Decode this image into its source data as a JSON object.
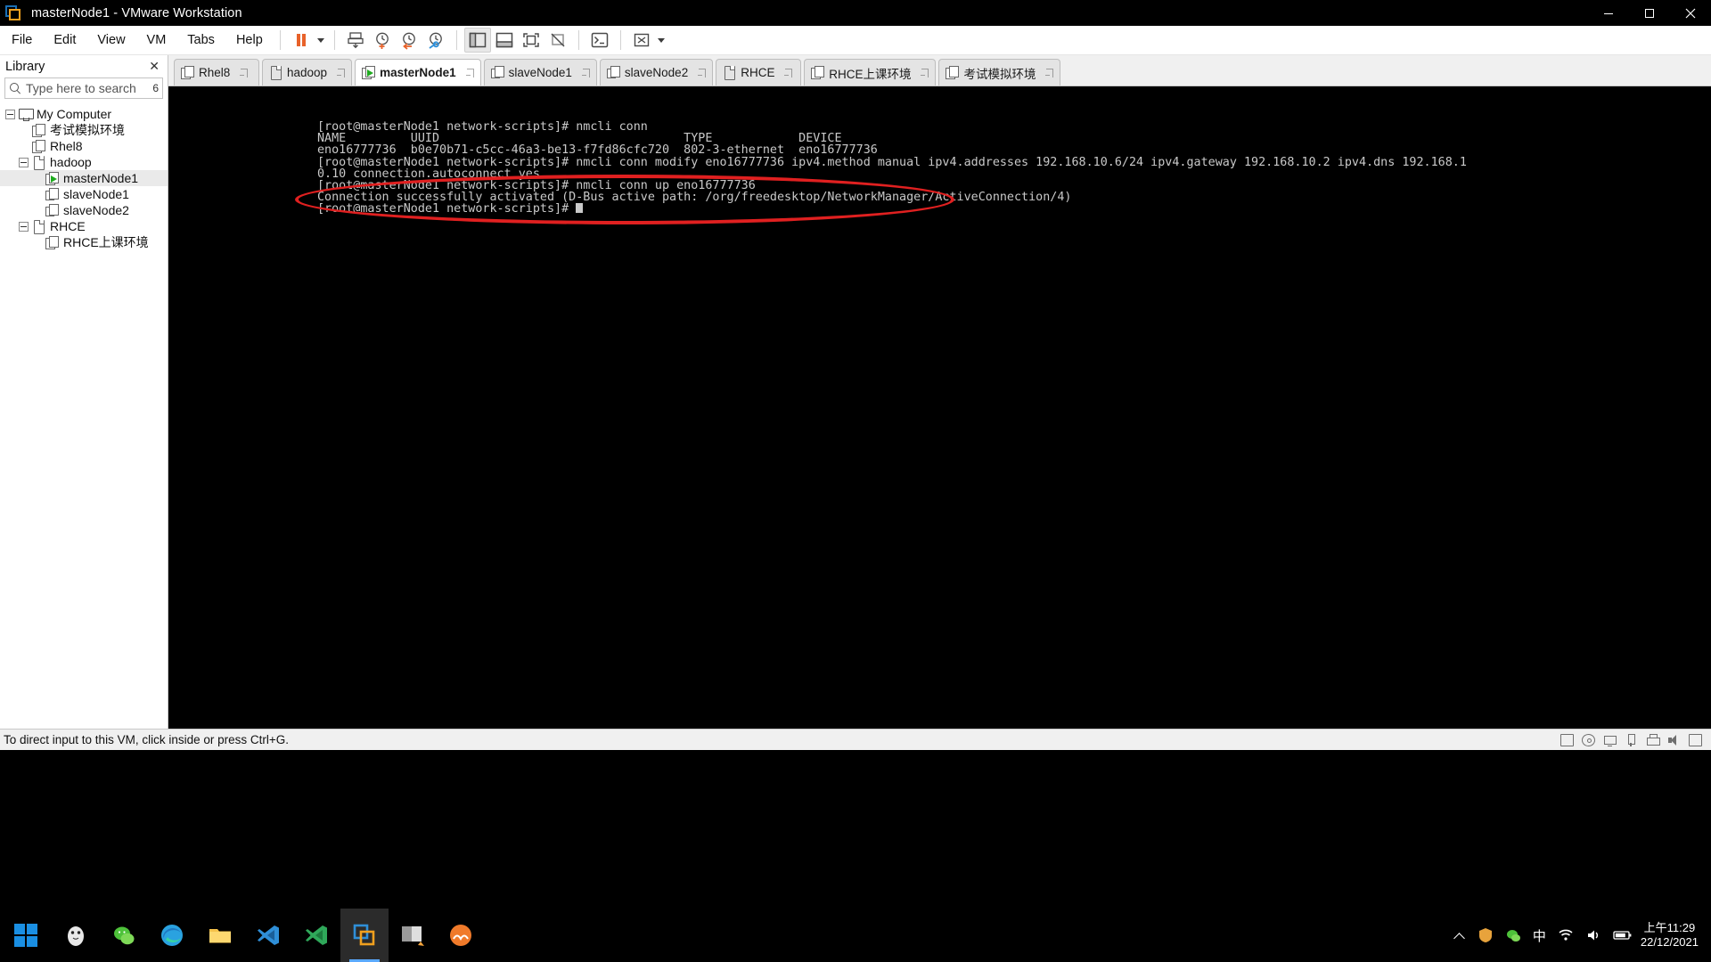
{
  "window": {
    "title": "masterNode1 - VMware Workstation",
    "logo_icon": "vmware-logo-icon",
    "minimize_icon": "minimize-icon",
    "maximize_icon": "maximize-icon",
    "close_icon": "close-icon"
  },
  "menubar": {
    "items": [
      {
        "label": "File"
      },
      {
        "label": "Edit"
      },
      {
        "label": "View"
      },
      {
        "label": "VM"
      },
      {
        "label": "Tabs"
      },
      {
        "label": "Help"
      }
    ],
    "toolbar": [
      {
        "name": "suspend-button",
        "icon": "pause-icon"
      },
      {
        "name": "power-dropdown",
        "icon": "chevron-down-icon"
      },
      {
        "name": "send-ctrl-alt-del-button",
        "icon": "keyboard-send-icon"
      },
      {
        "name": "snapshot-button",
        "icon": "clock-plus-icon"
      },
      {
        "name": "revert-snapshot-button",
        "icon": "clock-back-icon"
      },
      {
        "name": "snapshot-manager-button",
        "icon": "clock-wrench-icon"
      },
      {
        "name": "show-library-button",
        "icon": "sidebar-panel-icon"
      },
      {
        "name": "show-thumbnails-button",
        "icon": "bottom-panel-icon"
      },
      {
        "name": "fullscreen-button",
        "icon": "fullscreen-icon"
      },
      {
        "name": "unity-mode-button",
        "icon": "unity-mode-icon"
      },
      {
        "name": "console-view-button",
        "icon": "console-icon"
      },
      {
        "name": "stretch-view-button",
        "icon": "expand-arrows-icon"
      },
      {
        "name": "stretch-dropdown",
        "icon": "chevron-down-icon"
      }
    ]
  },
  "sidebar": {
    "header": "Library",
    "close_icon": "close-icon",
    "search": {
      "placeholder": "Type here to search",
      "value": "",
      "icon": "search-icon",
      "count": "6"
    },
    "tree": [
      {
        "label": "My Computer",
        "indent": 0,
        "icon": "monitor-icon",
        "expander": "collapse",
        "selected": false
      },
      {
        "label": "考试模拟环境",
        "indent": 1,
        "icon": "vm-group-icon",
        "expander": "none",
        "selected": false
      },
      {
        "label": "Rhel8",
        "indent": 1,
        "icon": "vm-group-icon",
        "expander": "none",
        "selected": false
      },
      {
        "label": "hadoop",
        "indent": 1,
        "icon": "vm-single-icon",
        "expander": "collapse",
        "selected": false
      },
      {
        "label": "masterNode1",
        "indent": 2,
        "icon": "vm-running-icon",
        "expander": "none",
        "selected": true
      },
      {
        "label": "slaveNode1",
        "indent": 2,
        "icon": "vm-cluster-icon",
        "expander": "none",
        "selected": false
      },
      {
        "label": "slaveNode2",
        "indent": 2,
        "icon": "vm-cluster-icon",
        "expander": "none",
        "selected": false
      },
      {
        "label": "RHCE",
        "indent": 1,
        "icon": "vm-single-icon",
        "expander": "collapse",
        "selected": false
      },
      {
        "label": "RHCE上课环境",
        "indent": 2,
        "icon": "vm-group-icon",
        "expander": "none",
        "selected": false
      }
    ]
  },
  "tabs": [
    {
      "label": "Rhel8",
      "icon": "vm-group-icon",
      "active": false,
      "close_icon": "tab-close-icon"
    },
    {
      "label": "hadoop",
      "icon": "vm-single-icon",
      "active": false,
      "close_icon": "tab-close-icon"
    },
    {
      "label": "masterNode1",
      "icon": "vm-running-icon",
      "active": true,
      "close_icon": "tab-close-icon"
    },
    {
      "label": "slaveNode1",
      "icon": "vm-cluster-icon",
      "active": false,
      "close_icon": "tab-close-icon"
    },
    {
      "label": "slaveNode2",
      "icon": "vm-cluster-icon",
      "active": false,
      "close_icon": "tab-close-icon"
    },
    {
      "label": "RHCE",
      "icon": "vm-single-icon",
      "active": false,
      "close_icon": "tab-close-icon"
    },
    {
      "label": "RHCE上课环境",
      "icon": "vm-group-icon",
      "active": false,
      "close_icon": "tab-close-icon"
    },
    {
      "label": "考试模拟环境",
      "icon": "vm-group-icon",
      "active": false,
      "close_icon": "tab-close-icon"
    }
  ],
  "terminal": {
    "lines": [
      "[root@masterNode1 network-scripts]# nmcli conn",
      "NAME         UUID                                  TYPE            DEVICE",
      "eno16777736  b0e70b71-c5cc-46a3-be13-f7fd86cfc720  802-3-ethernet  eno16777736",
      "[root@masterNode1 network-scripts]# nmcli conn modify eno16777736 ipv4.method manual ipv4.addresses 192.168.10.6/24 ipv4.gateway 192.168.10.2 ipv4.dns 192.168.1",
      "0.10 connection.autoconnect yes",
      "[root@masterNode1 network-scripts]# nmcli conn up eno16777736",
      "Connection successfully activated (D-Bus active path: /org/freedesktop/NetworkManager/ActiveConnection/4)",
      "[root@masterNode1 network-scripts]# "
    ],
    "annotation": {
      "shape": "ellipse",
      "color": "#e02020"
    },
    "background": "#000000",
    "foreground": "#c9c9c9"
  },
  "statusbar": {
    "message": "To direct input to this VM, click inside or press Ctrl+G.",
    "icons": [
      "hard-disk-icon",
      "cd-drive-icon",
      "network-adapter-icon",
      "usb-device-icon",
      "printer-icon",
      "sound-card-icon",
      "display-icon"
    ]
  },
  "taskbar": {
    "start_icon": "windows-start-icon",
    "apps": [
      {
        "name": "taskbar-app-qq",
        "icon": "penguin-icon",
        "active": false
      },
      {
        "name": "taskbar-app-wechat",
        "icon": "wechat-icon",
        "active": false
      },
      {
        "name": "taskbar-app-edge",
        "icon": "edge-icon",
        "active": false
      },
      {
        "name": "taskbar-app-file-explorer",
        "icon": "folder-icon",
        "active": false
      },
      {
        "name": "taskbar-app-vscode",
        "icon": "vscode-icon",
        "active": false
      },
      {
        "name": "taskbar-app-vscode-insiders",
        "icon": "vscode-insiders-icon",
        "active": false
      },
      {
        "name": "taskbar-app-vmware",
        "icon": "vmware-icon",
        "active": true
      },
      {
        "name": "taskbar-app-screenshot",
        "icon": "snipping-tool-icon",
        "active": false
      },
      {
        "name": "taskbar-app-other",
        "icon": "orange-app-icon",
        "active": false
      }
    ],
    "tray": {
      "expand_icon": "chevron-up-icon",
      "icons": [
        "security-icon",
        "wechat-tray-icon",
        "ime-indicator",
        "wifi-icon",
        "volume-icon",
        "battery-icon"
      ],
      "ime_label": "中",
      "clock_time": "上午11:29",
      "clock_date": "22/12/2021"
    }
  }
}
